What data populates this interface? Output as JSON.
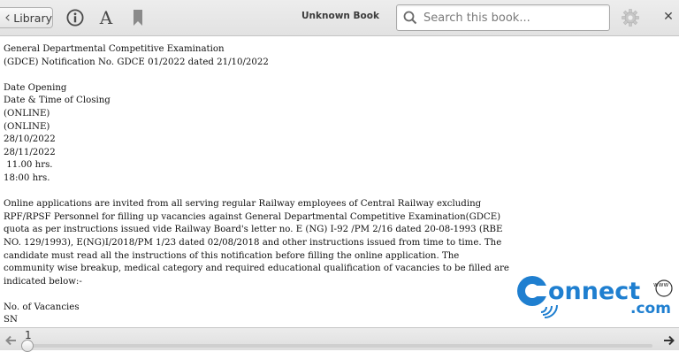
{
  "toolbar": {
    "library_label": "Library",
    "font_label": "A",
    "book_title": "Unknown Book",
    "search_placeholder": "Search this book..."
  },
  "document": {
    "lines": [
      "General Departmental Competitive Examination",
      "(GDCE) Notification No. GDCE 01/2022 dated 21/10/2022",
      "",
      "Date Opening",
      "Date & Time of Closing",
      "(ONLINE)",
      "(ONLINE)",
      "28/10/2022",
      "28/11/2022",
      " 11.00 hrs.",
      "18:00 hrs.",
      "",
      "Online applications are invited from all serving regular Railway employees of Central Railway excluding",
      "RPF/RPSF Personnel for filling up vacancies against General Departmental Competitive Examination(GDCE)",
      "quota as per instructions issued vide Railway Board's letter no. E (NG) I-92 /PM 2/16 dated 20-08-1993 (RBE",
      "NO. 129/1993), E(NG)I/2018/PM 1/23 dated 02/08/2018 and other instructions issued from time to time. The",
      "candidate must read all the instructions of this notification before filling the online application. The",
      "community wise breakup, medical category and required educational qualification of vacancies to be filled are",
      "indicated below:-",
      "",
      "No. of Vacancies",
      "SN"
    ]
  },
  "watermark": {
    "brand": "Connect",
    "www": "www",
    "tld": ".com",
    "colors": {
      "blue": "#1f7fd0",
      "dark": "#333333"
    }
  },
  "bottombar": {
    "page_number": "1",
    "progress_fraction": 0.0
  },
  "icons": [
    "chevron-left-icon",
    "info-icon",
    "font-icon",
    "bookmark-icon",
    "search-icon",
    "gear-icon",
    "close-icon",
    "arrow-left-icon",
    "arrow-right-icon"
  ],
  "colors": {
    "toolbar_bg": "#e6e6e6",
    "accent": "#1f7fd0"
  }
}
